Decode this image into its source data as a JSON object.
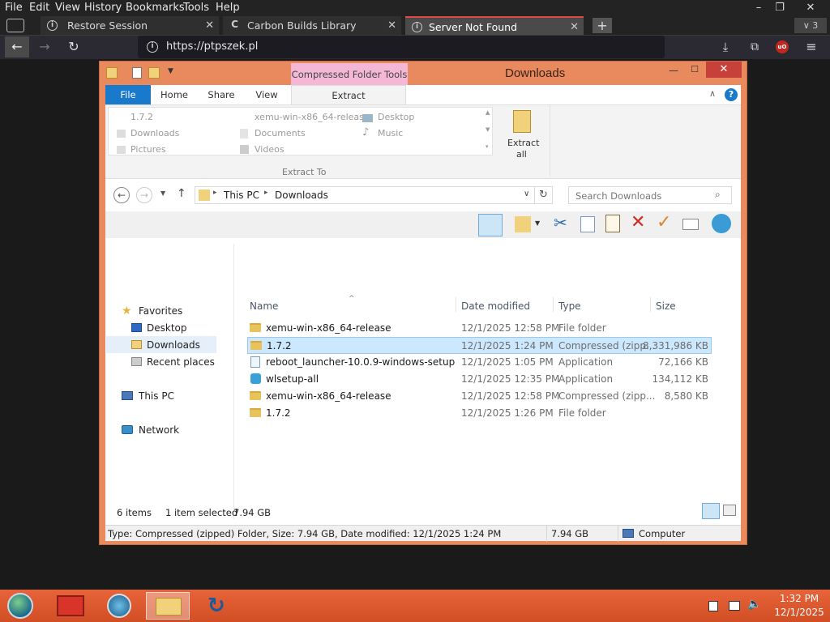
{
  "browser": {
    "menu": [
      "File",
      "Edit",
      "View",
      "History",
      "Bookmarks",
      "Tools",
      "Help"
    ],
    "tabs": [
      {
        "label": "Restore Session",
        "icon": "info-icon"
      },
      {
        "label": "Carbon Builds Library",
        "icon": "c-logo-icon"
      },
      {
        "label": "Server Not Found",
        "icon": "info-icon"
      }
    ],
    "tab_count": "3",
    "url": "https://ptpszek.pl"
  },
  "explorer": {
    "context_tab": "Compressed Folder Tools",
    "title": "Downloads",
    "ribbon_tabs": [
      "File",
      "Home",
      "Share",
      "View",
      "Extract"
    ],
    "extract_to": {
      "items": [
        "1.7.2",
        "xemu-win-x86_64-release",
        "Desktop",
        "Downloads",
        "Documents",
        "Music",
        "Pictures",
        "Videos"
      ],
      "group_label": "Extract To"
    },
    "extract_all": [
      "Extract",
      "all"
    ],
    "breadcrumb": [
      "This PC",
      "Downloads"
    ],
    "search_placeholder": "Search Downloads",
    "nav": {
      "favorites": "Favorites",
      "items": [
        "Desktop",
        "Downloads",
        "Recent places"
      ],
      "this_pc": "This PC",
      "network": "Network"
    },
    "columns": [
      "Name",
      "Date modified",
      "Type",
      "Size"
    ],
    "files": [
      {
        "name": "xemu-win-x86_64-release",
        "date": "12/1/2025 12:58 PM",
        "type": "File folder",
        "size": "",
        "icon": "folder-icon"
      },
      {
        "name": "1.7.2",
        "date": "12/1/2025 1:24 PM",
        "type": "Compressed (zipp...",
        "size": "8,331,986 KB",
        "icon": "zip-folder-icon"
      },
      {
        "name": "reboot_launcher-10.0.9-windows-setup",
        "date": "12/1/2025 1:05 PM",
        "type": "Application",
        "size": "72,166 KB",
        "icon": "installer-icon"
      },
      {
        "name": "wlsetup-all",
        "date": "12/1/2025 12:35 PM",
        "type": "Application",
        "size": "134,112 KB",
        "icon": "app-icon"
      },
      {
        "name": "xemu-win-x86_64-release",
        "date": "12/1/2025 12:58 PM",
        "type": "Compressed (zipp...",
        "size": "8,580 KB",
        "icon": "zip-folder-icon"
      },
      {
        "name": "1.7.2",
        "date": "12/1/2025 1:26 PM",
        "type": "File folder",
        "size": "",
        "icon": "folder-icon"
      }
    ],
    "item_count": "6 items",
    "selection": "1 item selected",
    "selection_size": "7.94 GB",
    "status_text": "Type: Compressed (zipped) Folder, Size: 7.94 GB, Date modified: 12/1/2025 1:24 PM",
    "status_size": "7.94 GB",
    "status_location": "Computer"
  },
  "taskbar": {
    "time": "1:32 PM",
    "date": "12/1/2025"
  },
  "colors": {
    "window_frame": "#e8895e",
    "taskbar": "#e05a30",
    "selection": "#cce8ff",
    "ribbon_file": "#1979ca"
  }
}
